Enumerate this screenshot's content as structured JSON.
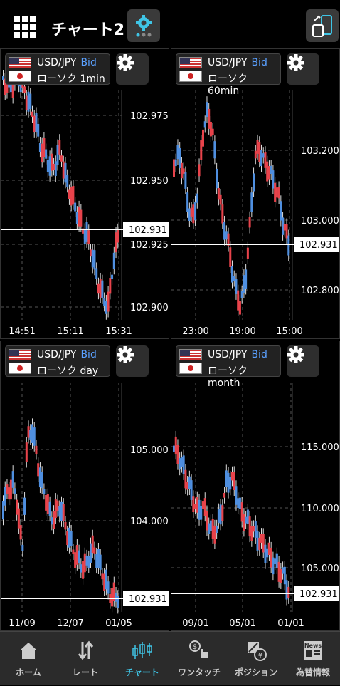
{
  "header": {
    "title": "チャート2"
  },
  "panels": [
    {
      "pair": "USD/JPY",
      "side": "Bid",
      "chart_type": "ローソク 1min",
      "price_labels": [
        "102.975",
        "102.950",
        "102.925",
        "102.900"
      ],
      "current_price": "102.931",
      "time_labels": [
        "14:51",
        "15:11",
        "15:31"
      ]
    },
    {
      "pair": "USD/JPY",
      "side": "Bid",
      "chart_type": "ローソク 60min",
      "price_labels": [
        "103.200",
        "103.000",
        "102.800"
      ],
      "current_price": "102.931",
      "time_labels": [
        "23:00",
        "19:00",
        "15:00"
      ]
    },
    {
      "pair": "USD/JPY",
      "side": "Bid",
      "chart_type": "ローソク day",
      "price_labels": [
        "105.000",
        "104.000"
      ],
      "current_price": "102.931",
      "time_labels": [
        "11/09",
        "12/07",
        "01/05"
      ]
    },
    {
      "pair": "USD/JPY",
      "side": "Bid",
      "chart_type": "ローソク month",
      "price_labels": [
        "115.000",
        "110.000",
        "105.000"
      ],
      "current_price": "102.931",
      "time_labels": [
        "09/01",
        "05/01",
        "01/01"
      ]
    }
  ],
  "tabs": [
    {
      "label": "ホーム",
      "icon": "home-icon"
    },
    {
      "label": "レート",
      "icon": "rate-arrows-icon"
    },
    {
      "label": "チャート",
      "icon": "candlestick-icon",
      "active": true
    },
    {
      "label": "ワンタッチ",
      "icon": "one-touch-icon"
    },
    {
      "label": "ポジション",
      "icon": "position-icon"
    },
    {
      "label": "為替情報",
      "icon": "news-icon"
    }
  ],
  "colors": {
    "up": "#e8434b",
    "down": "#4f8fe0",
    "accent": "#3fc5e6"
  }
}
